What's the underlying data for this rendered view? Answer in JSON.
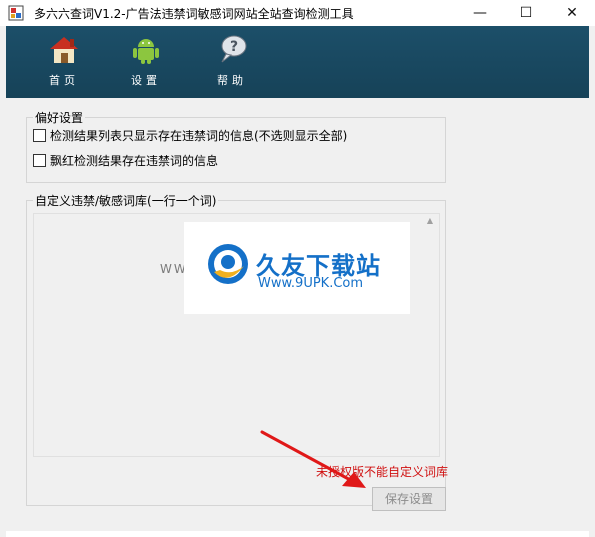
{
  "window": {
    "title": "多六六查词V1.2-广告法违禁词敏感词网站全站查询检测工具",
    "minimize_glyph": "—",
    "maximize_glyph": "☐",
    "close_glyph": "✕"
  },
  "toolbar": {
    "items": [
      {
        "label": "首页",
        "icon": "house-icon"
      },
      {
        "label": "设置",
        "icon": "android-icon"
      },
      {
        "label": "帮助",
        "icon": "help-bubble-icon"
      }
    ],
    "background": "#1c4f69"
  },
  "preferences": {
    "legend": "偏好设置",
    "options": [
      {
        "label": "检测结果列表只显示存在违禁词的信息(不选则显示全部)",
        "checked": false
      },
      {
        "label": "飘红检测结果存在违禁词的信息",
        "checked": false
      }
    ]
  },
  "lexicon": {
    "legend": "自定义违禁/敏感词库(一行一个词)",
    "value": ""
  },
  "watermark": {
    "brand": "久友下载站",
    "url": "Www.9UPK.Com",
    "side_text": "WWW.9UPK.COM"
  },
  "footer": {
    "warning": "未授权版不能自定义词库",
    "warning_color": "#d01010",
    "save_label": "保存设置"
  }
}
